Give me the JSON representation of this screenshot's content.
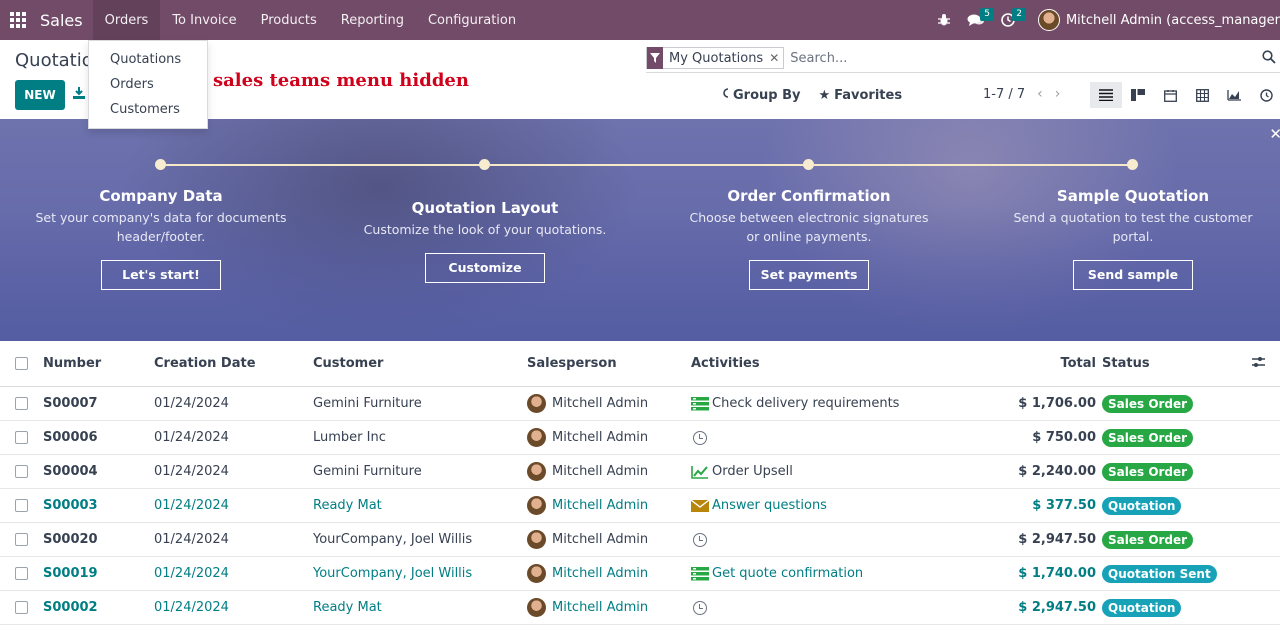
{
  "navbar": {
    "app_name": "Sales",
    "menu": [
      "Orders",
      "To Invoice",
      "Products",
      "Reporting",
      "Configuration"
    ],
    "messages_count": "5",
    "activities_count": "2",
    "user_name": "Mitchell Admin (access_manager"
  },
  "orders_menu": {
    "items": [
      "Quotations",
      "Orders",
      "Customers"
    ]
  },
  "annotation": "sales teams menu hidden",
  "control_panel": {
    "title": "Quotatio",
    "new_label": "NEW",
    "facet_label": "My Quotations",
    "search_placeholder": "Search...",
    "group_by_label": "Group By",
    "favorites_label": "Favorites",
    "pager": "1-7 / 7"
  },
  "banner": {
    "steps": [
      {
        "title": "Company Data",
        "desc_1": "Set your company's data for documents",
        "desc_2": "header/footer.",
        "button": "Let's start!"
      },
      {
        "title": "Quotation Layout",
        "desc_1": "Customize the look of your quotations.",
        "desc_2": "",
        "button": "Customize"
      },
      {
        "title": "Order Confirmation",
        "desc_1": "Choose between electronic signatures",
        "desc_2": "or online payments.",
        "button": "Set payments"
      },
      {
        "title": "Sample Quotation",
        "desc_1": "Send a quotation to test the customer",
        "desc_2": "portal.",
        "button": "Send sample"
      }
    ]
  },
  "table": {
    "headers": {
      "number": "Number",
      "creation_date": "Creation Date",
      "customer": "Customer",
      "salesperson": "Salesperson",
      "activities": "Activities",
      "total": "Total",
      "status": "Status"
    },
    "rows": [
      {
        "number": "S00007",
        "date": "01/24/2024",
        "customer": "Gemini Furniture",
        "salesperson": "Mitchell Admin",
        "activity": "Check delivery requirements",
        "activity_icon": "todo-icon",
        "total": "$ 1,706.00",
        "status": "Sales Order"
      },
      {
        "number": "S00006",
        "date": "01/24/2024",
        "customer": "Lumber Inc",
        "salesperson": "Mitchell Admin",
        "activity": "",
        "activity_icon": "clock-icon",
        "total": "$ 750.00",
        "status": "Sales Order"
      },
      {
        "number": "S00004",
        "date": "01/24/2024",
        "customer": "Gemini Furniture",
        "salesperson": "Mitchell Admin",
        "activity": "Order Upsell",
        "activity_icon": "upsell-chart-icon",
        "total": "$ 2,240.00",
        "status": "Sales Order"
      },
      {
        "number": "S00003",
        "date": "01/24/2024",
        "customer": "Ready Mat",
        "salesperson": "Mitchell Admin",
        "activity": "Answer questions",
        "activity_icon": "email-icon",
        "total": "$ 377.50",
        "status": "Quotation"
      },
      {
        "number": "S00020",
        "date": "01/24/2024",
        "customer": "YourCompany, Joel Willis",
        "salesperson": "Mitchell Admin",
        "activity": "",
        "activity_icon": "clock-icon",
        "total": "$ 2,947.50",
        "status": "Sales Order"
      },
      {
        "number": "S00019",
        "date": "01/24/2024",
        "customer": "YourCompany, Joel Willis",
        "salesperson": "Mitchell Admin",
        "activity": "Get quote confirmation",
        "activity_icon": "todo-icon",
        "total": "$ 1,740.00",
        "status": "Quotation Sent"
      },
      {
        "number": "S00002",
        "date": "01/24/2024",
        "customer": "Ready Mat",
        "salesperson": "Mitchell Admin",
        "activity": "",
        "activity_icon": "clock-icon",
        "total": "$ 2,947.50",
        "status": "Quotation"
      }
    ]
  },
  "colors": {
    "brand": "#714b67",
    "accent": "#017e84",
    "sales_order": "#28a745",
    "quotation": "#17a2b8"
  }
}
